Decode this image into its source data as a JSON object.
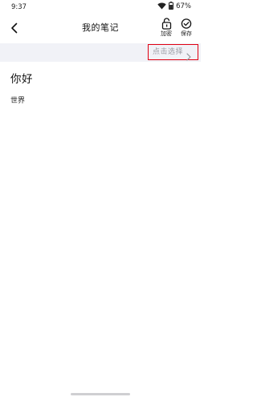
{
  "status_bar": {
    "time": "9:37",
    "battery": "67%",
    "icons": [
      "wifi-icon",
      "battery-icon"
    ]
  },
  "header": {
    "title": "我的笔记",
    "back_icon": "chevron-left-icon",
    "actions": {
      "encrypt": {
        "label": "加密",
        "icon": "lock-icon"
      },
      "save": {
        "label": "保存",
        "icon": "check-circle-icon"
      }
    }
  },
  "selector": {
    "label": "点击选择",
    "icon": "chevron-right-icon",
    "highlight_color": "#e00012"
  },
  "note": {
    "title": "你好",
    "body": "世界"
  }
}
